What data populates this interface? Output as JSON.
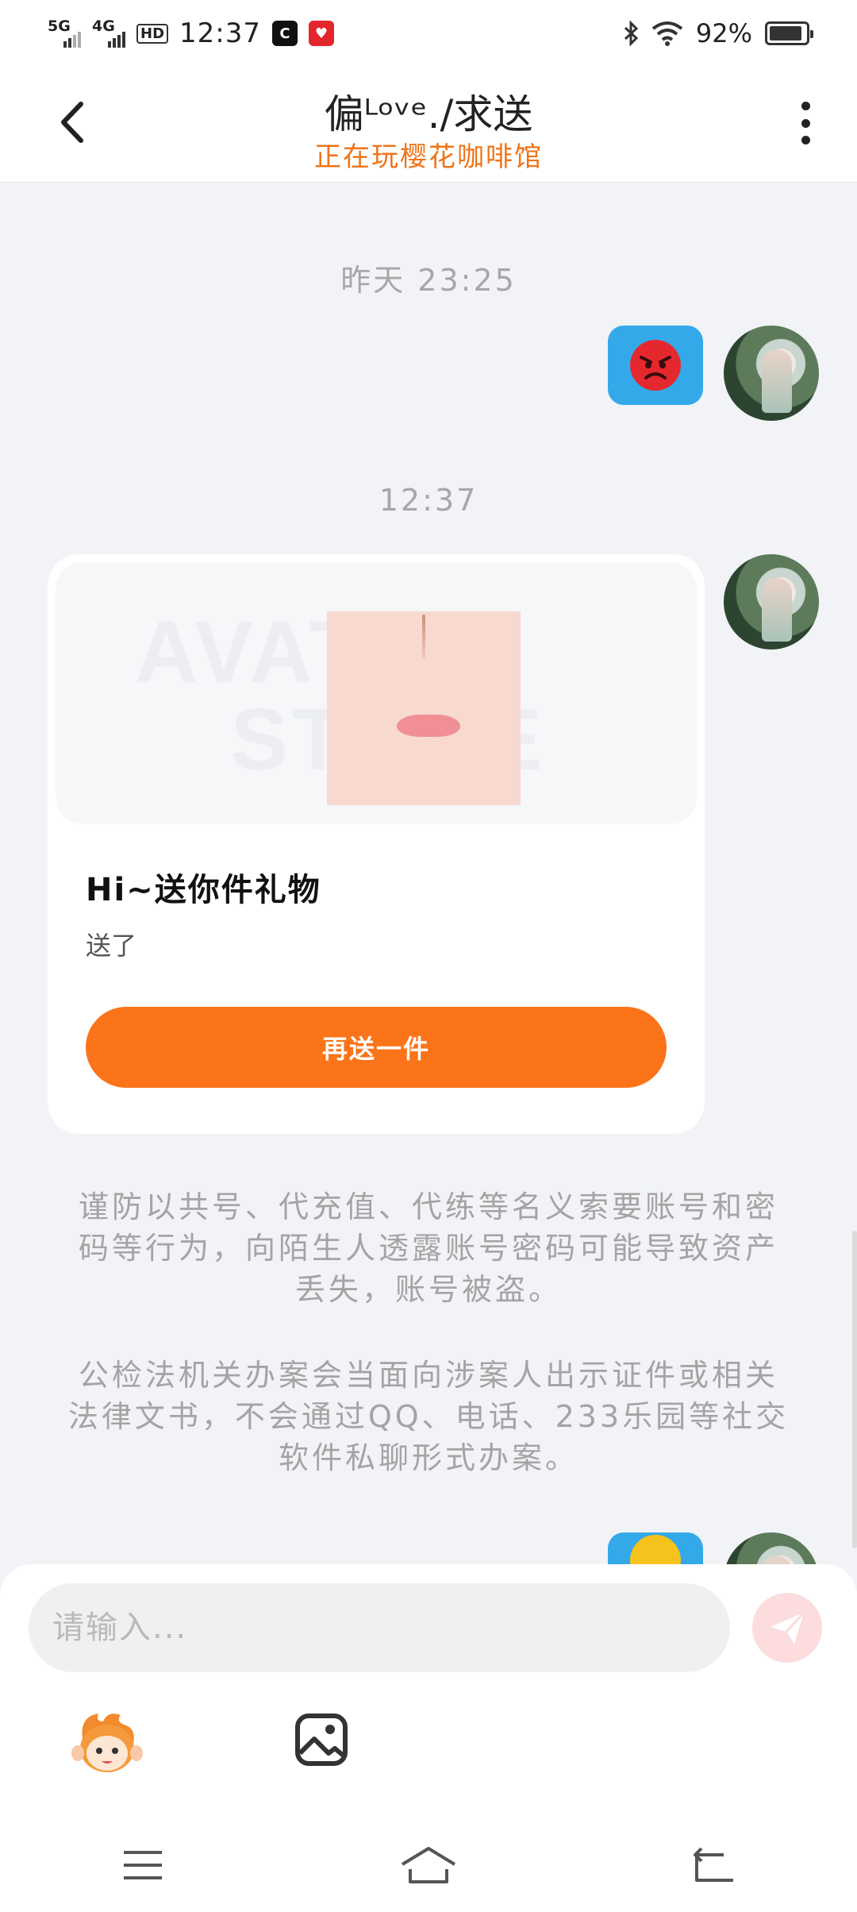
{
  "status_bar": {
    "network1": "5G",
    "network2": "4G",
    "hd": "HD",
    "time": "12:37",
    "battery": "92%",
    "battery_level": 0.92
  },
  "header": {
    "title": "偏ᴸᵒᵛᵉ./求送",
    "subtitle": "正在玩樱花咖啡馆",
    "back_icon": "chevron-left-icon",
    "more_icon": "vertical-dots-icon"
  },
  "chat": {
    "timestamp_1": "昨天 23:25",
    "timestamp_2": "12:37",
    "gift": {
      "watermark_1": "AVATAR",
      "watermark_2": "STORE",
      "title": "Hi~送你件礼物",
      "description": "送了",
      "button_label": "再送一件"
    },
    "notice_1": "谨防以共号、代充值、代练等名义索要账号和密码等行为，向陌生人透露账号密码可能导致资产丢失，账号被盗。",
    "notice_2": "公检法机关办案会当面向涉案人出示证件或相关法律文书，不会通过QQ、电话、233乐园等社交软件私聊形式办案。"
  },
  "composer": {
    "placeholder": "请输入...",
    "send_icon": "paper-plane-icon",
    "mascot_icon": "mascot-emoji-icon",
    "image_icon": "image-icon"
  },
  "colors": {
    "accent": "#fb7419",
    "subtitle": "#f07418",
    "bubble": "#34a9ea"
  }
}
